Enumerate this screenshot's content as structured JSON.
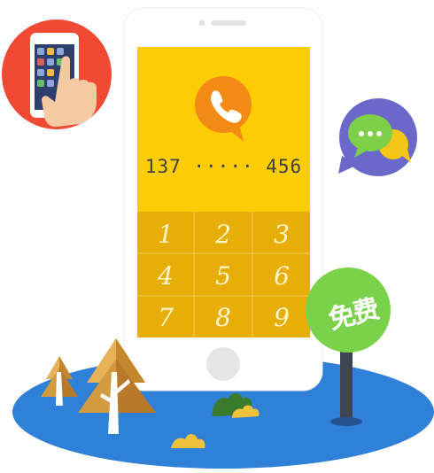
{
  "phone": {
    "number": "137 ····· 456"
  },
  "dialpad": {
    "keys": [
      "1",
      "2",
      "3",
      "4",
      "5",
      "6",
      "7",
      "8",
      "9"
    ]
  },
  "badge": {
    "label": "免费"
  },
  "colors": {
    "screen": "#fccd05",
    "keypad": "#e7ad08",
    "call_bubble": "#f28a16",
    "message_bubble_bg": "#6a68c9",
    "left_circle": "#f04a35",
    "ground": "#2f80d7",
    "badge": "#7ad24a"
  },
  "icons": {
    "call": "phone-call-icon",
    "chat": "chat-bubbles-icon",
    "hand": "hand-tapping-phone-icon"
  }
}
